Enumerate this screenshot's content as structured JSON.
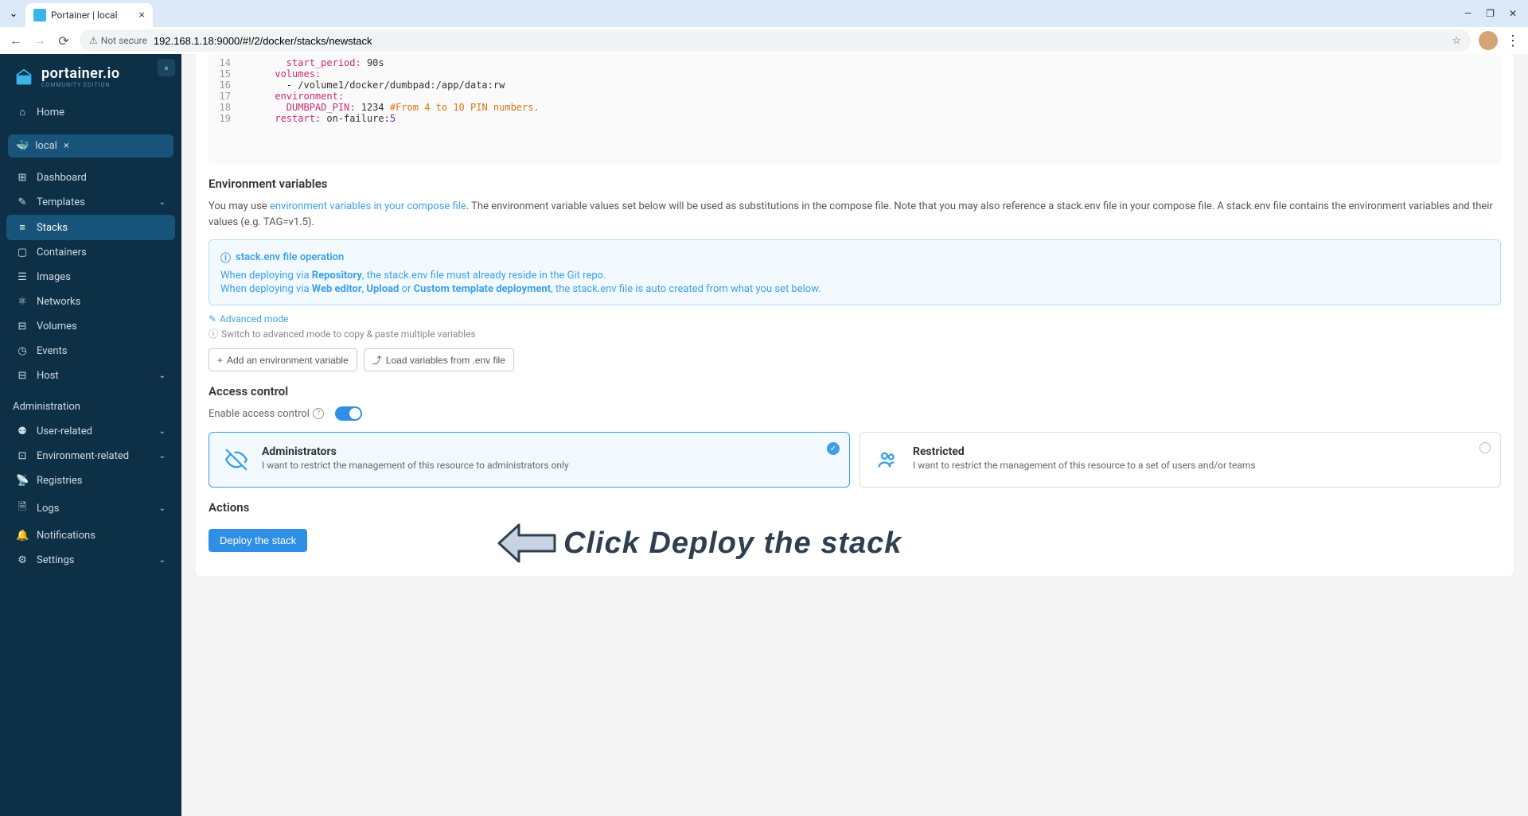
{
  "browser": {
    "tab_title": "Portainer | local",
    "url": "192.168.1.18:9000/#!/2/docker/stacks/newstack",
    "not_secure": "Not secure"
  },
  "sidebar": {
    "logo": "portainer.io",
    "logo_sub": "COMMUNITY EDITION",
    "home": "Home",
    "env_name": "local",
    "items": [
      {
        "icon": "⊞",
        "label": "Dashboard"
      },
      {
        "icon": "✎",
        "label": "Templates",
        "chevron": true
      },
      {
        "icon": "≡",
        "label": "Stacks",
        "active": true
      },
      {
        "icon": "▢",
        "label": "Containers"
      },
      {
        "icon": "☰",
        "label": "Images"
      },
      {
        "icon": "⚛",
        "label": "Networks"
      },
      {
        "icon": "⊟",
        "label": "Volumes"
      },
      {
        "icon": "◷",
        "label": "Events"
      },
      {
        "icon": "⊟",
        "label": "Host",
        "chevron": true
      }
    ],
    "admin_label": "Administration",
    "admin_items": [
      {
        "icon": "⚉",
        "label": "User-related",
        "chevron": true
      },
      {
        "icon": "⊡",
        "label": "Environment-related",
        "chevron": true
      },
      {
        "icon": "📡",
        "label": "Registries"
      },
      {
        "icon": "🗎",
        "label": "Logs",
        "chevron": true
      },
      {
        "icon": "🔔",
        "label": "Notifications"
      },
      {
        "icon": "⚙",
        "label": "Settings",
        "chevron": true
      }
    ]
  },
  "code": {
    "lines": [
      {
        "num": "14",
        "indent": "        ",
        "key": "start_period",
        "val": " 90s"
      },
      {
        "num": "15",
        "indent": "      ",
        "key": "volumes",
        "val": ""
      },
      {
        "num": "16",
        "indent": "        ",
        "plain": "- /volume1/docker/dumbpad:/app/data:rw"
      },
      {
        "num": "17",
        "indent": "      ",
        "key": "environment",
        "val": ""
      },
      {
        "num": "18",
        "indent": "        ",
        "key": "DUMBPAD_PIN",
        "val": " 1234 ",
        "comment": "#From 4 to 10 PIN numbers."
      },
      {
        "num": "19",
        "indent": "      ",
        "key": "restart",
        "val": " on-failure:",
        "num_suffix": "5"
      }
    ]
  },
  "env_vars": {
    "title": "Environment variables",
    "desc_pre": "You may use ",
    "desc_link": "environment variables in your compose file",
    "desc_post": ". The environment variable values set below will be used as substitutions in the compose file. Note that you may also reference a stack.env file in your compose file. A stack.env file contains the environment variables and their values (e.g. TAG=v1.5).",
    "info_title": "stack.env file operation",
    "info_line1_pre": "When deploying via ",
    "info_line1_b": "Repository",
    "info_line1_post": ", the stack.env file must already reside in the Git repo.",
    "info_line2_pre": "When deploying via ",
    "info_line2_b1": "Web editor",
    "info_line2_sep1": ", ",
    "info_line2_b2": "Upload",
    "info_line2_sep2": " or ",
    "info_line2_b3": "Custom template deployment",
    "info_line2_post": ", the stack.env file is auto created from what you set below.",
    "advanced": "Advanced mode",
    "hint": "Switch to advanced mode to copy & paste multiple variables",
    "add_btn": "Add an environment variable",
    "load_btn": "Load variables from .env file"
  },
  "access": {
    "title": "Access control",
    "enable_label": "Enable access control",
    "admin_title": "Administrators",
    "admin_desc": "I want to restrict the management of this resource to administrators only",
    "restricted_title": "Restricted",
    "restricted_desc": "I want to restrict the management of this resource to a set of users and/or teams"
  },
  "actions": {
    "title": "Actions",
    "deploy": "Deploy the stack"
  },
  "annotation": "Click Deploy the stack"
}
